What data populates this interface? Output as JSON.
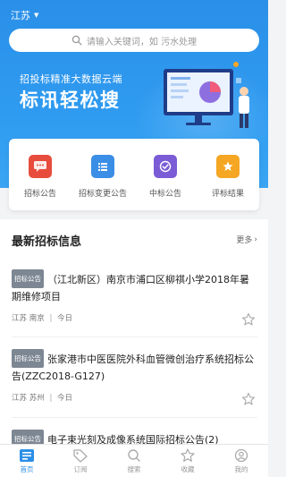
{
  "header": {
    "region": "江苏",
    "search_placeholder": "请输入关键词，如 污水处理"
  },
  "banner": {
    "subtitle": "招投标精准大数据云端",
    "title": "标讯轻松搜"
  },
  "categories": [
    {
      "label": "招标公告",
      "icon": "chat-icon",
      "color": "#e84c3d"
    },
    {
      "label": "招标变更公告",
      "icon": "list-icon",
      "color": "#3a8ee6"
    },
    {
      "label": "中标公告",
      "icon": "check-icon",
      "color": "#7b5cd6"
    },
    {
      "label": "评标结果",
      "icon": "star-icon",
      "color": "#f5a623"
    }
  ],
  "latest": {
    "heading": "最新招标信息",
    "more": "更多",
    "items": [
      {
        "tag": "招标公告",
        "title": "（江北新区）南京市浦口区柳祺小学2018年暑期维修项目",
        "province": "江苏",
        "city": "南京",
        "date": "今日"
      },
      {
        "tag": "招标公告",
        "title": "张家港市中医医院外科血管微创治疗系统招标公告(ZZC2018-G127)",
        "province": "江苏",
        "city": "苏州",
        "date": "今日"
      },
      {
        "tag": "招标公告",
        "title": "电子束光刻及成像系统国际招标公告(2)"
      }
    ]
  },
  "tabbar": [
    {
      "label": "首页",
      "active": true
    },
    {
      "label": "订阅",
      "active": false
    },
    {
      "label": "搜索",
      "active": false
    },
    {
      "label": "收藏",
      "active": false
    },
    {
      "label": "我的",
      "active": false
    }
  ],
  "colors": {
    "primary": "#2b8fe8",
    "tag_bg": "#7d8793"
  }
}
